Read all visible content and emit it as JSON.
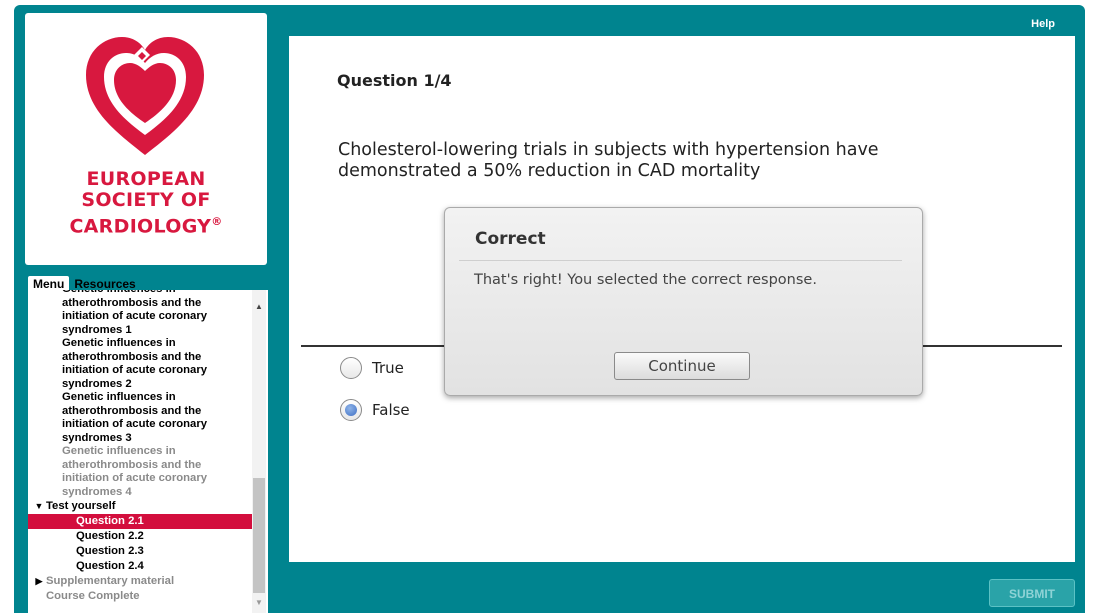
{
  "header": {
    "help_label": "Help"
  },
  "logo": {
    "line1": "EUROPEAN",
    "line2": "SOCIETY OF",
    "line3": "CARDIOLOGY",
    "registered": "®",
    "brand_color": "#d8183f"
  },
  "tabs": {
    "menu": "Menu",
    "resources": "Resources"
  },
  "menu": {
    "items": [
      {
        "label": "Genetic influences in atherothrombosis and the initiation of acute coronary syndromes 1",
        "state": "visited"
      },
      {
        "label": "Genetic influences in atherothrombosis and the initiation of acute coronary syndromes 2",
        "state": "visited"
      },
      {
        "label": "Genetic influences in atherothrombosis and the initiation of acute coronary syndromes 3",
        "state": "visited"
      },
      {
        "label": "Genetic influences in atherothrombosis and the initiation of acute coronary syndromes 4",
        "state": "unvisited"
      }
    ],
    "test_section": "Test yourself",
    "questions": [
      "Question 2.1",
      "Question 2.2",
      "Question 2.3",
      "Question 2.4"
    ],
    "current_question": "Question 2.1",
    "supplementary": "Supplementary material",
    "course_complete": "Course Complete"
  },
  "question": {
    "number": "Question 1/4",
    "text": "Cholesterol-lowering trials in subjects with hypertension have demonstrated a 50% reduction in CAD mortality",
    "options": [
      {
        "label": "True",
        "selected": false
      },
      {
        "label": "False",
        "selected": true
      }
    ]
  },
  "dialog": {
    "title": "Correct",
    "message": "That's right!  You selected the correct response.",
    "continue_label": "Continue"
  },
  "footer": {
    "submit_label": "SUBMIT"
  },
  "colors": {
    "frame": "#00848f",
    "highlight": "#d30e3d"
  }
}
